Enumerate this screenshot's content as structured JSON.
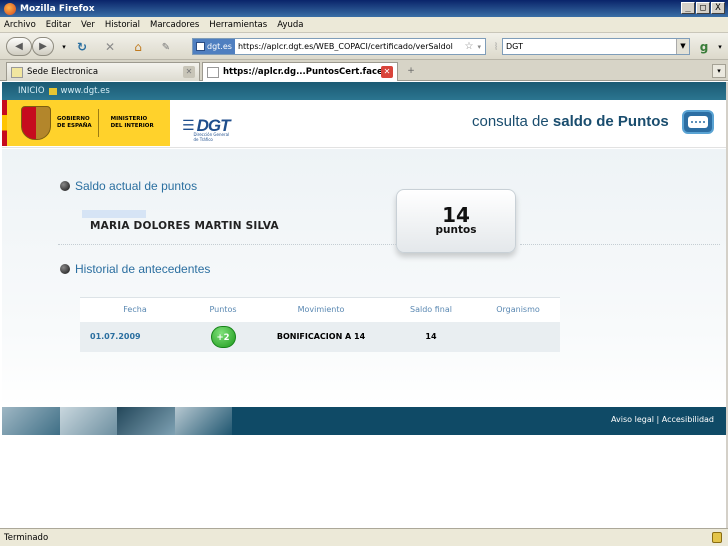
{
  "window": {
    "title": "Mozilla Firefox",
    "minimize": "_",
    "maximize": "□",
    "close": "X"
  },
  "menu": [
    "Archivo",
    "Editar",
    "Ver",
    "Historial",
    "Marcadores",
    "Herramientas",
    "Ayuda"
  ],
  "navbar": {
    "site_identity": "dgt.es",
    "url": "https://aplcr.dgt.es/WEB_COPACI/certificado/verSaldol",
    "search_value": "DGT"
  },
  "tabs": [
    {
      "label": "Sede Electronica",
      "active": false
    },
    {
      "label": "https://aplcr.dg...PuntosCert.faces",
      "active": true
    }
  ],
  "page": {
    "topstrip": {
      "inicio": "INICIO",
      "site": "www.dgt.es"
    },
    "header": {
      "gobierno": [
        "GOBIERNO",
        "DE ESPAÑA"
      ],
      "ministerio": [
        "MINISTERIO",
        "DEL INTERIOR"
      ],
      "dgt_mark": "DGT",
      "dgt_sub": "Dirección General de Tráfico",
      "consulta_prefix": "consulta de",
      "consulta_bold": "saldo de Puntos"
    },
    "saldo": {
      "title": "Saldo actual de puntos",
      "name": "MARIA DOLORES  MARTIN  SILVA",
      "points_value": "14",
      "points_label": "puntos"
    },
    "historial": {
      "title": "Historial de antecedentes",
      "columns": [
        "Fecha",
        "Puntos",
        "Movimiento",
        "Saldo final",
        "Organismo"
      ],
      "rows": [
        {
          "fecha": "01.07.2009",
          "puntos": "+2",
          "movimiento": "BONIFICACION A 14",
          "saldo_final": "14",
          "organismo": ""
        }
      ]
    },
    "footer": {
      "aviso": "Aviso legal",
      "sep": "|",
      "accesibilidad": "Accesibilidad"
    }
  },
  "status": {
    "text": "Terminado"
  }
}
